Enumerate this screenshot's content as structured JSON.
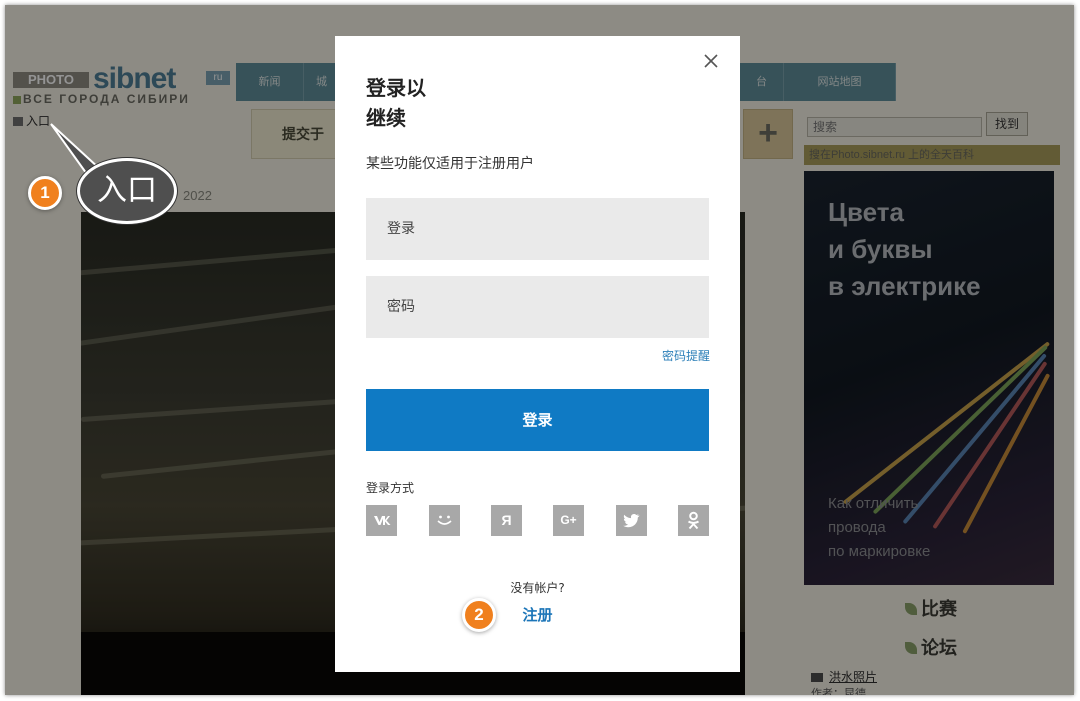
{
  "site": {
    "logo": {
      "photo": "PHOTO",
      "sibnet": "sibnet",
      "ru": "ru",
      "tagline": "ВСЕ ГОРОДА СИБИРИ"
    },
    "nav_tabs": [
      {
        "label": "新闻"
      },
      {
        "label": "城"
      },
      {
        "label": "台"
      },
      {
        "label": "网站地图"
      }
    ],
    "entry_link": "入口",
    "submit_label": "提交于",
    "plus_label": "+",
    "year_text": "2022",
    "search": {
      "placeholder": "搜索",
      "button": "找到"
    },
    "find_strip": "搜在Photo.sibnet.ru 上的全天百科",
    "ad": {
      "headline": [
        "Цвета",
        "и буквы",
        "в электрике"
      ],
      "subline": [
        "Как отличить",
        "провода",
        "по маркировке"
      ]
    },
    "side_links": [
      {
        "label": "比赛"
      },
      {
        "label": "论坛"
      }
    ],
    "news_item": "洪水照片",
    "author": "作者：昆德"
  },
  "annotation": {
    "callout_label": "入口",
    "step_badges": [
      "1",
      "2"
    ]
  },
  "modal": {
    "title": "登录以\n继续",
    "title_line1": "登录以",
    "title_line2": "继续",
    "subtitle": "某些功能仅适用于注册用户",
    "login_field_placeholder": "登录",
    "password_field_placeholder": "密码",
    "forgot_password": "密码提醒",
    "login_button": "登录",
    "methods_label": "登录方式",
    "social": [
      {
        "name": "vk",
        "glyph": "vk"
      },
      {
        "name": "mailru",
        "glyph": "smile"
      },
      {
        "name": "yandex",
        "glyph": "Я"
      },
      {
        "name": "google-plus",
        "glyph": "G+"
      },
      {
        "name": "twitter",
        "glyph": "bird"
      },
      {
        "name": "odnoklassniki",
        "glyph": "ok"
      }
    ],
    "no_account": "没有帐户?",
    "register": "注册"
  },
  "colors": {
    "primary_button": "#0f7ac4",
    "link": "#1b75b8",
    "badge": "#f0801e",
    "overlay": "rgba(0,0,0,0.42)"
  }
}
